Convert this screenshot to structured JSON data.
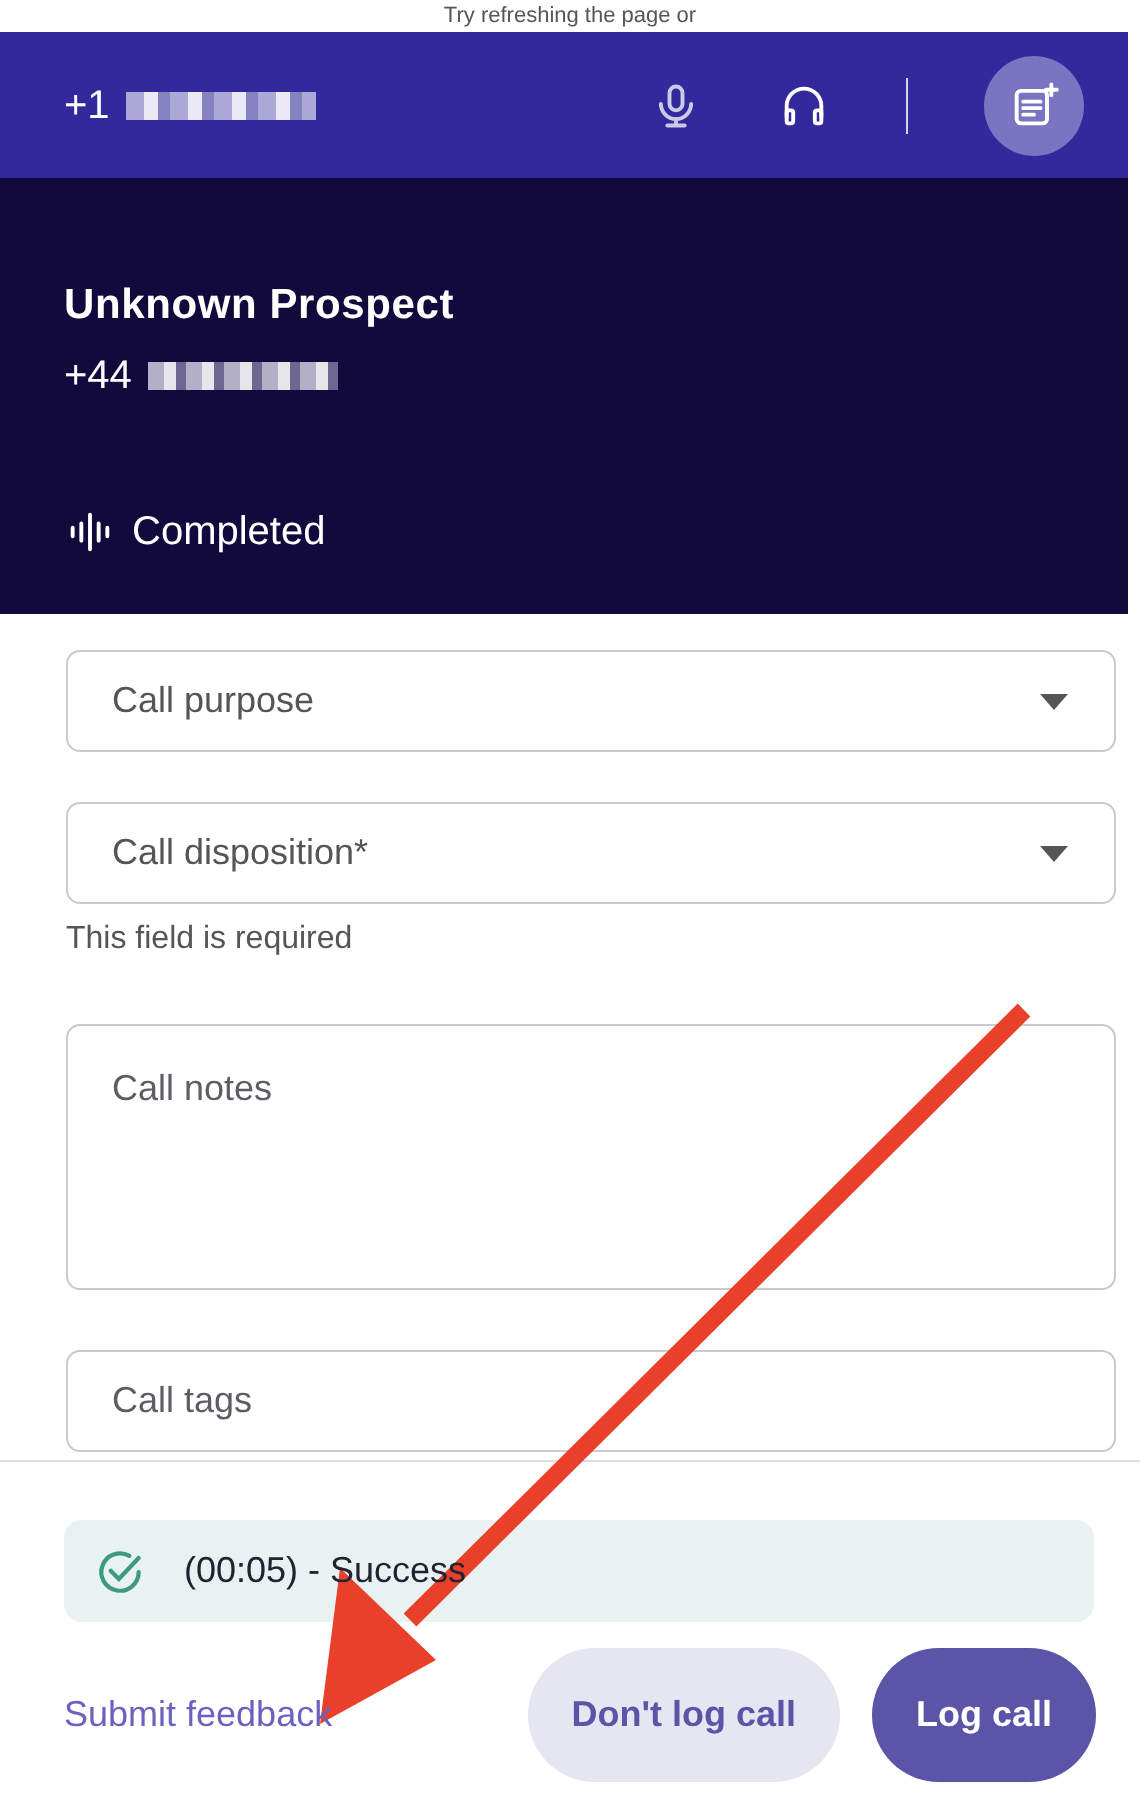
{
  "behind_text": "Try refreshing the page or",
  "top_bar": {
    "caller_prefix": "+1",
    "caller_redacted": true
  },
  "prospect": {
    "name": "Unknown Prospect",
    "phone_prefix": "+44",
    "phone_redacted": true,
    "status": "Completed"
  },
  "fields": [
    {
      "kind": "select",
      "placeholder": "Call purpose"
    },
    {
      "kind": "select",
      "placeholder": "Call disposition*",
      "error": "This field is required"
    },
    {
      "kind": "textarea",
      "placeholder": "Call notes"
    },
    {
      "kind": "text",
      "placeholder": "Call tags"
    }
  ],
  "result": {
    "text": "(00:05) - Success"
  },
  "footer": {
    "link": "Submit feedback",
    "buttons": [
      {
        "label": "Don't log call",
        "kind": "secondary"
      },
      {
        "label": "Log call",
        "kind": "primary"
      }
    ]
  },
  "annotation": {
    "kind": "arrow"
  }
}
